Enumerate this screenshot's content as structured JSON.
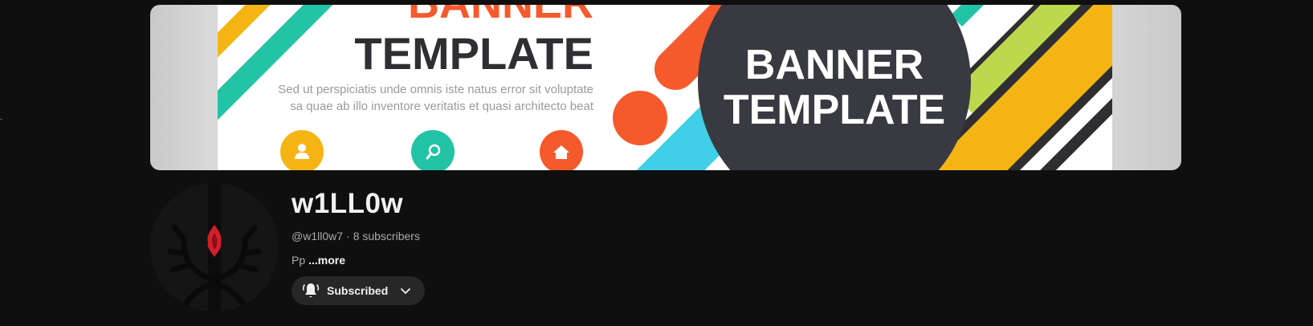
{
  "banner": {
    "heading_top": "BANNER",
    "heading": "TEMPLATE",
    "body_line1": "Sed ut perspiciatis unde omnis iste natus error sit voluptate",
    "body_line2": "sa quae ab illo inventore veritatis et quasi architecto beat",
    "circle_line1": "BANNER",
    "circle_line2": "TEMPLATE",
    "icons": [
      "user-icon",
      "search-icon",
      "home-icon"
    ],
    "colors": {
      "yellow": "#f4b514",
      "teal": "#22c3a6",
      "orange": "#f55a2c",
      "lime": "#bcd94d",
      "cyan": "#40cfe6",
      "dark": "#393a41"
    }
  },
  "channel": {
    "name": "w1LL0w",
    "handle": "@w1ll0w7",
    "separator": "·",
    "subscribers": "8 subscribers",
    "description": "Pp",
    "more_label": "...more",
    "subscribe_label": "Subscribed"
  }
}
